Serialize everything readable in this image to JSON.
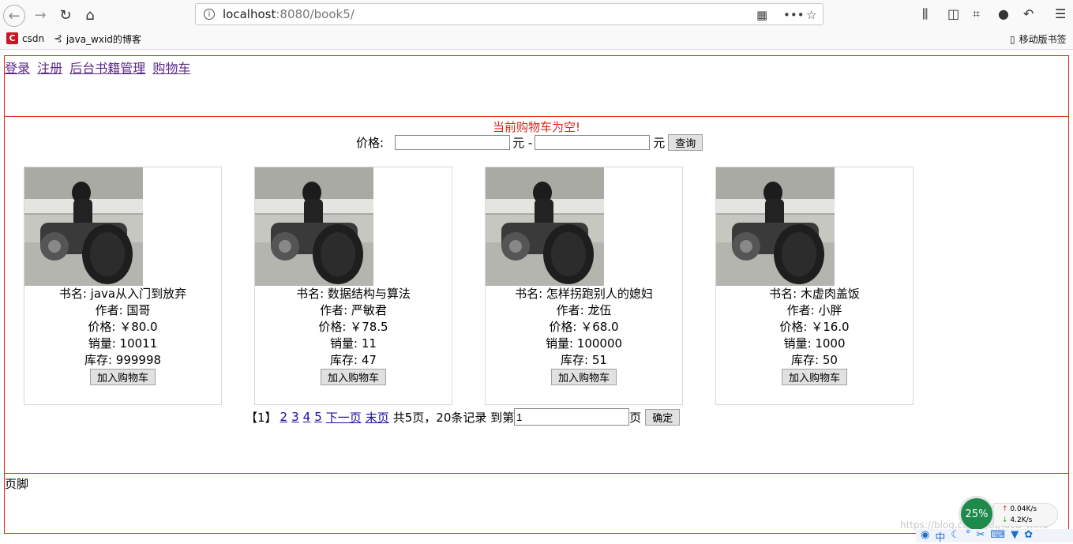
{
  "browser": {
    "url_host": "localhost",
    "url_rest": ":8080/book5/",
    "bookmarks": [
      "csdn",
      "java_wxid的博客"
    ],
    "mobile_bookmarks": "移动版书签"
  },
  "header": {
    "links": [
      "登录",
      "注册",
      "后台书籍管理",
      "购物车"
    ]
  },
  "main": {
    "cart_message": "当前购物车为空!",
    "price_label": "价格:",
    "unit": "元 -",
    "unit2": "元",
    "query_button": "查询",
    "books": [
      {
        "name": "书名: java从入门到放弃",
        "author": "作者: 国哥",
        "price": "价格: ￥80.0",
        "sales": "销量: 10011",
        "stock": "库存: 999998",
        "button": "加入购物车"
      },
      {
        "name": "书名: 数据结构与算法",
        "author": "作者: 严敏君",
        "price": "价格: ￥78.5",
        "sales": "销量: 11",
        "stock": "库存: 47",
        "button": "加入购物车"
      },
      {
        "name": "书名: 怎样拐跑别人的媳妇",
        "author": "作者: 龙伍",
        "price": "价格: ￥68.0",
        "sales": "销量: 100000",
        "stock": "库存: 51",
        "button": "加入购物车"
      },
      {
        "name": "书名: 木虚肉盖饭",
        "author": "作者: 小胖",
        "price": "价格: ￥16.0",
        "sales": "销量: 1000",
        "stock": "库存: 50",
        "button": "加入购物车"
      }
    ],
    "pager": {
      "current": "【1】",
      "pages": [
        "2",
        "3",
        "4",
        "5"
      ],
      "next": "下一页",
      "last": "末页",
      "summary": "共5页，20条记录 到第",
      "page_input": "1",
      "page_suffix": "页",
      "confirm": "确定"
    }
  },
  "footer": {
    "text": "页脚"
  },
  "widget": {
    "percent": "25%",
    "up": "0.04K/s",
    "down": "4.2K/s"
  },
  "watermark": "https://blog.csdn.net/java_wxid"
}
